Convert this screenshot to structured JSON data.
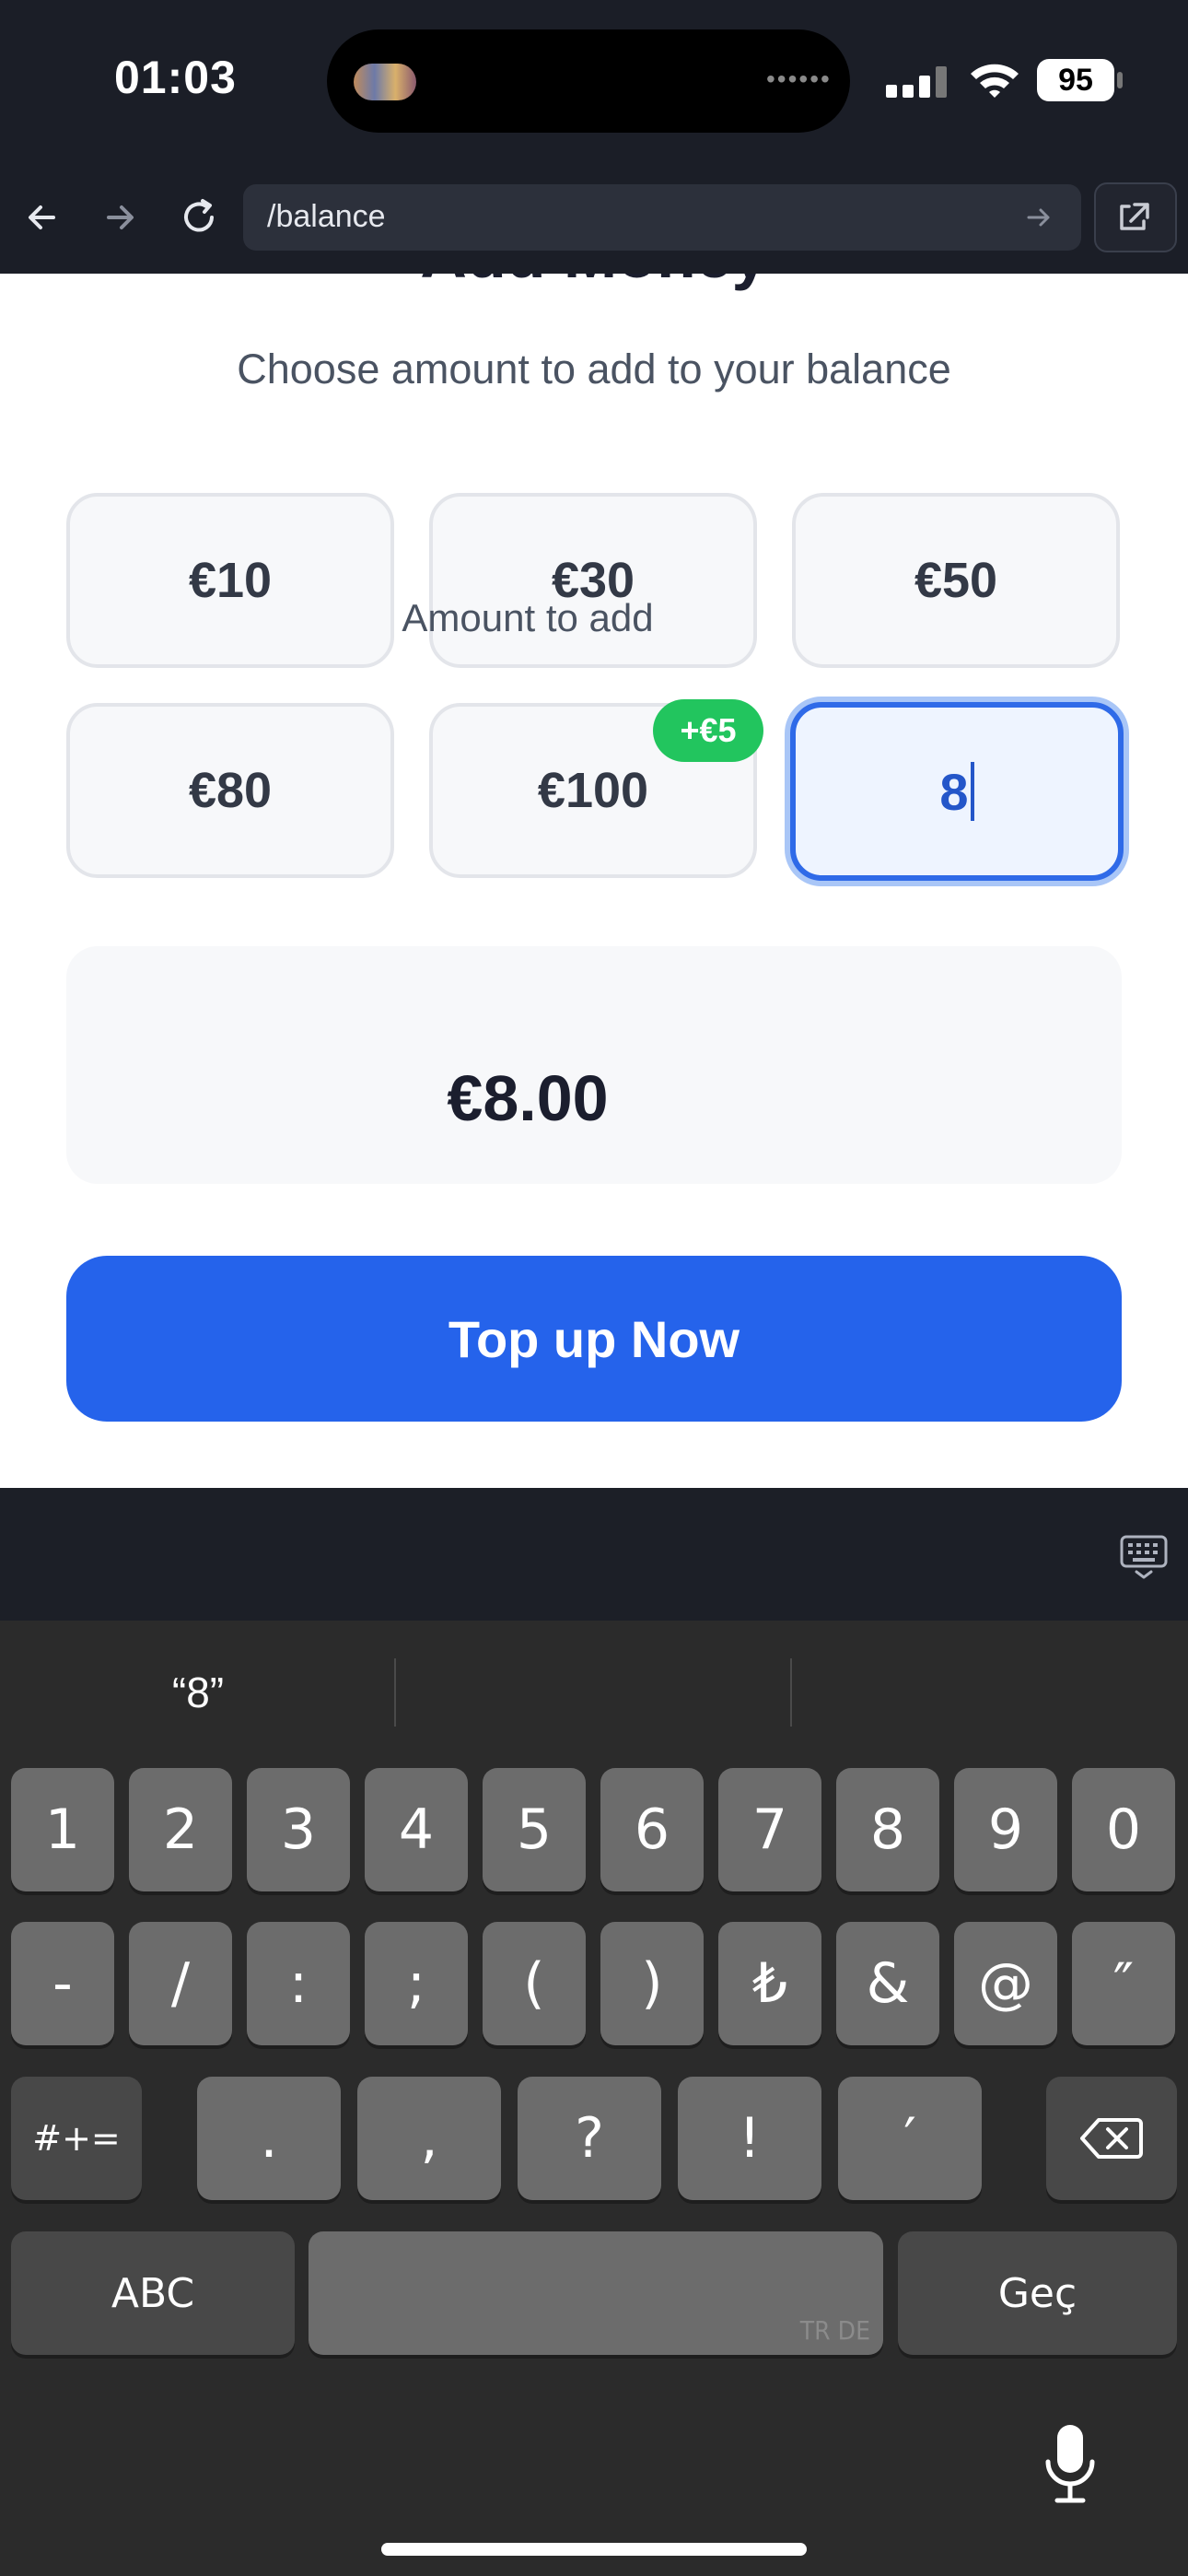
{
  "status_bar": {
    "time": "01:03",
    "island_dots": "••••••",
    "battery": "95"
  },
  "browser": {
    "url": "/balance"
  },
  "page": {
    "title": "Add Money",
    "subtitle": "Choose amount to add to your balance",
    "amounts": [
      "€10",
      "€30",
      "€50",
      "€80",
      "€100"
    ],
    "bonus_badge": "+€5",
    "custom_value": "8",
    "summary_label": "Amount to add",
    "summary_value": "€8.00",
    "topup_label": "Top up Now"
  },
  "keyboard": {
    "suggestion": "“8”",
    "row1": [
      "1",
      "2",
      "3",
      "4",
      "5",
      "6",
      "7",
      "8",
      "9",
      "0"
    ],
    "row2": [
      "-",
      "/",
      ":",
      ";",
      "(",
      ")",
      "₺",
      "&",
      "@",
      "″"
    ],
    "row3": [
      ".",
      ",",
      "?",
      "!",
      "′"
    ],
    "symbols_key": "#+=",
    "abc_key": "ABC",
    "space_tag": "TR DE",
    "return_key": "Geç"
  }
}
